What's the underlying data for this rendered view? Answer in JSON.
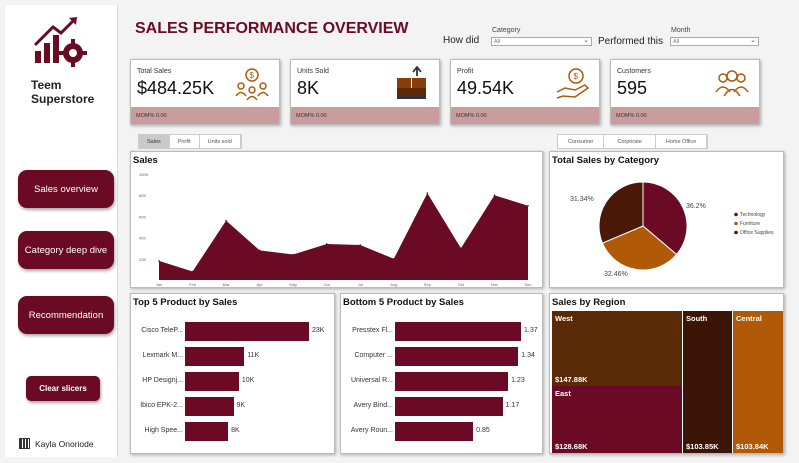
{
  "sidebar": {
    "brand": "Teem Superstore",
    "nav": [
      "Sales overview",
      "Category deep dive",
      "Recommendation"
    ],
    "clear_label": "Clear slicers",
    "author": "Kayla Onoriode"
  },
  "header": {
    "title": "SALES PERFORMANCE OVERVIEW",
    "how_did": "How did",
    "performed_this": "Performed this",
    "category_caption": "Category",
    "category_value": "All",
    "month_caption": "Month",
    "month_value": "All"
  },
  "kpis": [
    {
      "label": "Total Sales",
      "value": "$484.25K",
      "mom": "MOM% 0.00",
      "icon": "money-bag-people-icon"
    },
    {
      "label": "Units Sold",
      "value": "8K",
      "mom": "MOM% 0.00",
      "icon": "boxes-icon"
    },
    {
      "label": "Profit",
      "value": "49.54K",
      "mom": "MOM% 0.00",
      "icon": "hand-money-icon"
    },
    {
      "label": "Customers",
      "value": "595",
      "mom": "MOM% 0.00",
      "icon": "people-group-icon"
    }
  ],
  "metric_toggle": [
    "Sales",
    "Profit",
    "Units sold"
  ],
  "segment_toggle": [
    "Consumer",
    "Corporate",
    "Home Office"
  ],
  "colors": {
    "maroon": "#6b0a24",
    "brown": "#5a2a06",
    "orange": "#b05a08",
    "dark": "#3b1506",
    "kpi_band": "#c99c9e"
  },
  "chart_data": [
    {
      "type": "area",
      "title": "Sales",
      "categories": [
        "Jan",
        "Feb",
        "Mar",
        "Apr",
        "May",
        "Jun",
        "Jul",
        "Aug",
        "Sep",
        "Oct",
        "Nov",
        "Dec"
      ],
      "values": [
        18,
        8,
        56,
        28,
        24,
        34,
        33,
        20,
        82,
        30,
        80,
        70
      ],
      "yticks": [
        "100K",
        "80K",
        "60K",
        "40K",
        "20K"
      ],
      "ylim": [
        0,
        100
      ]
    },
    {
      "type": "pie",
      "title": "Total Sales by Category",
      "labels": [
        "Technology",
        "Furniture",
        "Office Supplies"
      ],
      "values": [
        36.2,
        32.46,
        31.34
      ],
      "value_labels": [
        "36.2%",
        "32.46%",
        "31.34%"
      ],
      "colors": [
        "#6b0a24",
        "#b05a08",
        "#4a1806"
      ]
    },
    {
      "type": "bar",
      "title": "Top 5 Product by Sales",
      "categories": [
        "Cisco TeleP...",
        "Lexmark M...",
        "HP Designj...",
        "Ibico EPK-2...",
        "High Spee..."
      ],
      "values": [
        23,
        11,
        10,
        9,
        8
      ],
      "value_labels": [
        "23K",
        "11K",
        "10K",
        "9K",
        "8K"
      ]
    },
    {
      "type": "bar",
      "title": "Bottom 5 Product by Sales",
      "categories": [
        "Presstex Fl...",
        "Computer ...",
        "Universal R...",
        "Avery Bind...",
        "Avery Roun..."
      ],
      "values": [
        1.37,
        1.34,
        1.23,
        1.17,
        0.85
      ],
      "value_labels": [
        "1.37",
        "1.34",
        "1.23",
        "1.17",
        "0.85"
      ]
    },
    {
      "type": "heatmap",
      "title": "Sales by Region",
      "regions": [
        {
          "name": "West",
          "value": "$147.88K"
        },
        {
          "name": "East",
          "value": "$128.68K"
        },
        {
          "name": "South",
          "value": "$103.85K"
        },
        {
          "name": "Central",
          "value": "$103.84K"
        }
      ]
    }
  ]
}
